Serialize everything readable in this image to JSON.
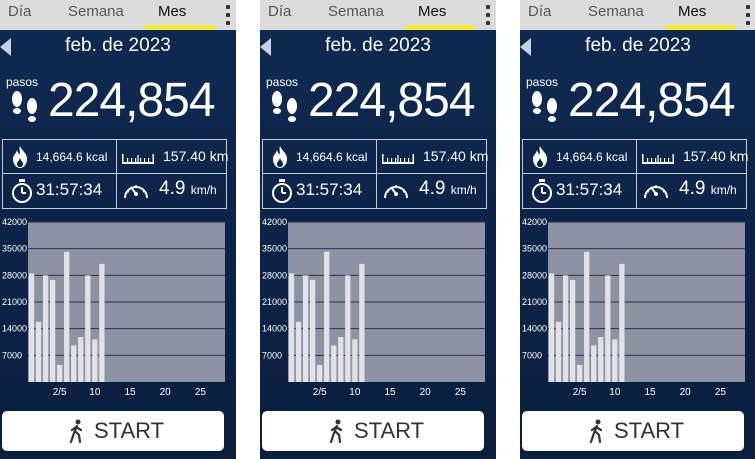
{
  "tabs": [
    "Día",
    "Semana",
    "Mes"
  ],
  "active_tab": "Mes",
  "accent_color": "#f3ec3a",
  "header": {
    "date": "feb. de 2023"
  },
  "steps": {
    "label": "pasos",
    "value": "224,854"
  },
  "stats": {
    "calories": "14,664.6 kcal",
    "distance": "157.40 km",
    "time": "31:57:34",
    "speed": "4.9",
    "speed_unit": "km/h"
  },
  "icons": [
    "foot-steps-icon",
    "flame-icon",
    "ruler-icon",
    "stopwatch-icon",
    "speedometer-icon",
    "walking-person-icon",
    "back-arrow-icon",
    "more-vert-icon"
  ],
  "start_label": "START",
  "chart_data": {
    "type": "bar",
    "x": [
      1,
      2,
      3,
      4,
      5,
      6,
      7,
      8,
      9,
      10,
      11
    ],
    "values": [
      28500,
      15800,
      28000,
      26800,
      4500,
      34200,
      9600,
      11800,
      28000,
      11200,
      31000
    ],
    "x_ticks": [
      "2/5",
      "10",
      "15",
      "20",
      "25"
    ],
    "x_tick_values": [
      5,
      10,
      15,
      20,
      25
    ],
    "y_ticks": [
      7000,
      14000,
      21000,
      28000,
      35000,
      42000
    ],
    "xlim": [
      0.5,
      28.5
    ],
    "ylim": [
      0,
      42000
    ],
    "grid": true,
    "bar_color": "#e2e2e6",
    "plot_color": "#8d93a3"
  }
}
